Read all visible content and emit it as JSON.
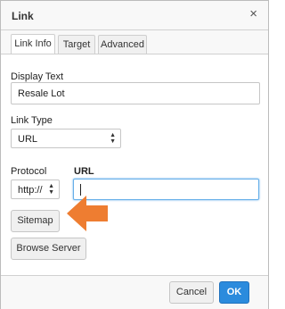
{
  "dialog": {
    "title": "Link",
    "close_glyph": "×"
  },
  "tabs": [
    {
      "label": "Link Info",
      "active": true
    },
    {
      "label": "Target",
      "active": false
    },
    {
      "label": "Advanced",
      "active": false
    }
  ],
  "form": {
    "display_text_label": "Display Text",
    "display_text_value": "Resale Lot",
    "link_type_label": "Link Type",
    "link_type_value": "URL",
    "protocol_label": "Protocol",
    "protocol_value": "http://",
    "url_label": "URL",
    "url_value": ""
  },
  "buttons": {
    "sitemap": "Sitemap",
    "browse_server": "Browse Server",
    "cancel": "Cancel",
    "ok": "OK"
  },
  "colors": {
    "arrow": "#ee7d31",
    "ok_button": "#2b8bdd",
    "focus_border": "#66afe9"
  },
  "icons": {
    "close": "close-icon",
    "pointer": "orange-arrow-icon"
  }
}
